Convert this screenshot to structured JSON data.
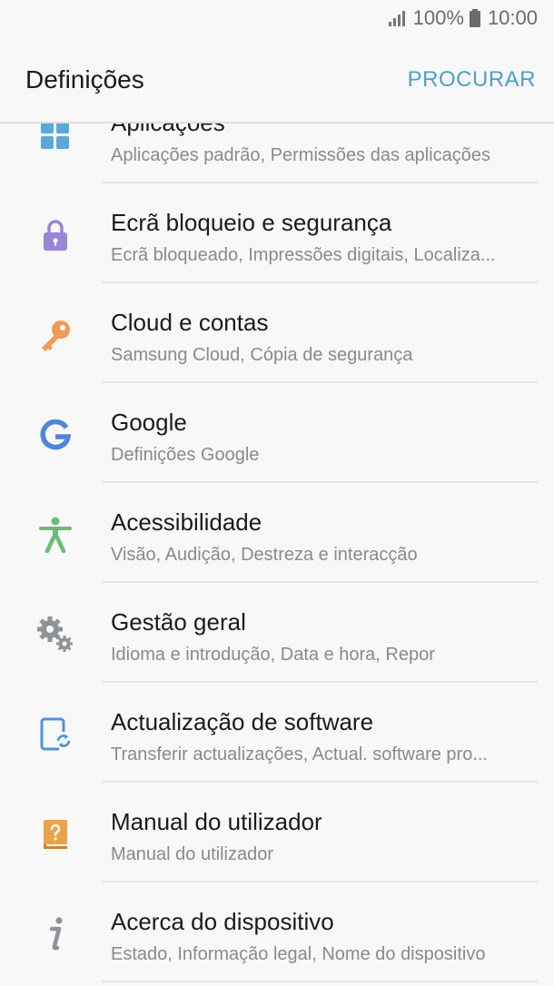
{
  "status": {
    "battery": "100%",
    "time": "10:00"
  },
  "header": {
    "title": "Definições",
    "search_label": "PROCURAR"
  },
  "settings": [
    {
      "title": "Aplicações",
      "subtitle": "Aplicações padrão, Permissões das aplicações",
      "icon": "apps-grid-icon",
      "color": "#5ba8d8"
    },
    {
      "title": "Ecrã bloqueio e segurança",
      "subtitle": "Ecrã bloqueado, Impressões digitais, Localiza...",
      "icon": "lock-icon",
      "color": "#9a84d6"
    },
    {
      "title": "Cloud e contas",
      "subtitle": "Samsung Cloud, Cópia de segurança",
      "icon": "key-icon",
      "color": "#f09a5a"
    },
    {
      "title": "Google",
      "subtitle": "Definições Google",
      "icon": "google-icon",
      "color": "#4f86d9"
    },
    {
      "title": "Acessibilidade",
      "subtitle": "Visão, Audição, Destreza e interacção",
      "icon": "accessibility-icon",
      "color": "#6dbb7a"
    },
    {
      "title": "Gestão geral",
      "subtitle": "Idioma e introdução, Data e hora, Repor",
      "icon": "gears-icon",
      "color": "#8e9398"
    },
    {
      "title": "Actualização de software",
      "subtitle": "Transferir actualizações, Actual. software pro...",
      "icon": "software-update-icon",
      "color": "#4e93d8"
    },
    {
      "title": "Manual do utilizador",
      "subtitle": "Manual do utilizador",
      "icon": "user-manual-icon",
      "color": "#eba34a"
    },
    {
      "title": "Acerca do dispositivo",
      "subtitle": "Estado, Informação legal, Nome do dispositivo",
      "icon": "info-icon",
      "color": "#8e9398"
    }
  ]
}
